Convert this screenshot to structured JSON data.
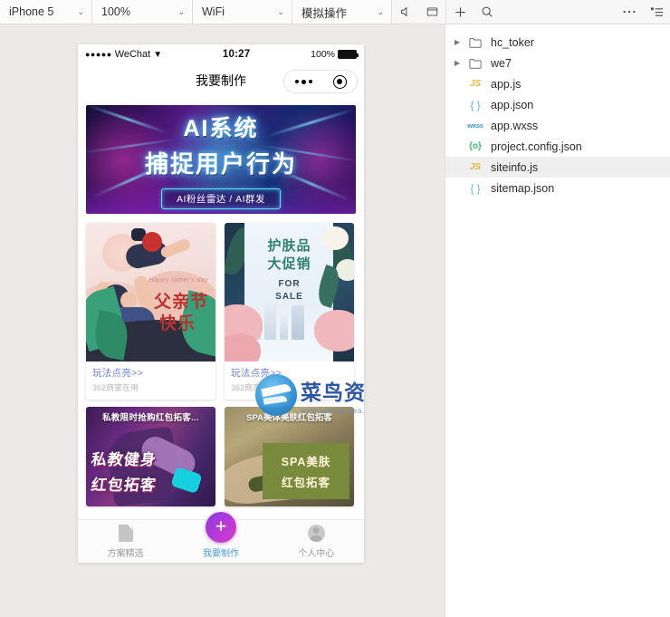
{
  "toolbar": {
    "device": {
      "label": "iPhone 5",
      "caret": "⌄"
    },
    "zoom": {
      "label": "100%",
      "caret": "⌄"
    },
    "network": {
      "label": "WiFi",
      "caret": "⌄"
    },
    "simulate": {
      "label": "模拟操作",
      "caret": "⌄"
    },
    "icons": {
      "mute": "mute-icon",
      "window": "window-icon",
      "add": "+",
      "search": "search-icon",
      "more": "···",
      "list": "list-icon"
    }
  },
  "phone": {
    "statusbar": {
      "signal_dots": "●●●●●",
      "carrier": "WeChat",
      "wifi": "▼",
      "time": "10:27",
      "battery_pct": "100%"
    },
    "navbar": {
      "title": "我要制作",
      "capsule": {
        "more": "•••",
        "target": "◉"
      }
    },
    "hero": {
      "line1": "AI系统",
      "line2": "捕捉用户行为",
      "tag": "AI粉丝雷达 / AI群发"
    },
    "cards": [
      {
        "id": "fathers-day",
        "en_text": "Happy father's day",
        "title_1": "父亲节",
        "title_2": "快乐",
        "action": "玩法点亮>>",
        "subtitle": "362商家在用"
      },
      {
        "id": "skincare",
        "title_1": "护肤品",
        "title_2": "大促销",
        "title_3": "FOR",
        "title_4": "SALE",
        "side_text": "护肤",
        "action": "玩法点亮>>",
        "subtitle": "362商家在用"
      }
    ],
    "cards_row2": [
      {
        "id": "fitness",
        "header": "私教限时抢购红包拓客...",
        "big_1": "私教健身",
        "big_2": "红包拓客"
      },
      {
        "id": "spa",
        "header": "SPA美体美肤红包拓客",
        "big_1": "SPA美肤",
        "big_2": "红包拓客"
      }
    ],
    "watermark": {
      "text": "菜鸟资源网",
      "url": "www.cainiaousea.com"
    },
    "tabbar": [
      {
        "label": "方案精选",
        "icon": "document-icon",
        "active": false
      },
      {
        "label": "我要制作",
        "icon": "plus-icon",
        "active": true
      },
      {
        "label": "个人中心",
        "icon": "user-icon",
        "active": false
      }
    ],
    "fab": {
      "glyph": "+"
    }
  },
  "filetree": [
    {
      "name": "hc_toker",
      "type": "folder",
      "arrow": "▶",
      "selected": false
    },
    {
      "name": "we7",
      "type": "folder",
      "arrow": "▶",
      "selected": false
    },
    {
      "name": "app.js",
      "type": "js",
      "icon": "JS",
      "selected": false
    },
    {
      "name": "app.json",
      "type": "json",
      "icon": "{ }",
      "selected": false
    },
    {
      "name": "app.wxss",
      "type": "wxss",
      "icon": "wxss",
      "selected": false
    },
    {
      "name": "project.config.json",
      "type": "cfg",
      "icon": "{o}",
      "selected": false
    },
    {
      "name": "siteinfo.js",
      "type": "js",
      "icon": "JS",
      "selected": true
    },
    {
      "name": "sitemap.json",
      "type": "json",
      "icon": "{ }",
      "selected": false
    }
  ],
  "colors": {
    "toolbar_bg": "#f7f7f7",
    "sim_bg": "#eceae8",
    "panel_bg": "#ffffff",
    "accent_active_tab": "#4a9fe0",
    "card_link": "#6d7fd4",
    "selected_row": "#efefef"
  }
}
